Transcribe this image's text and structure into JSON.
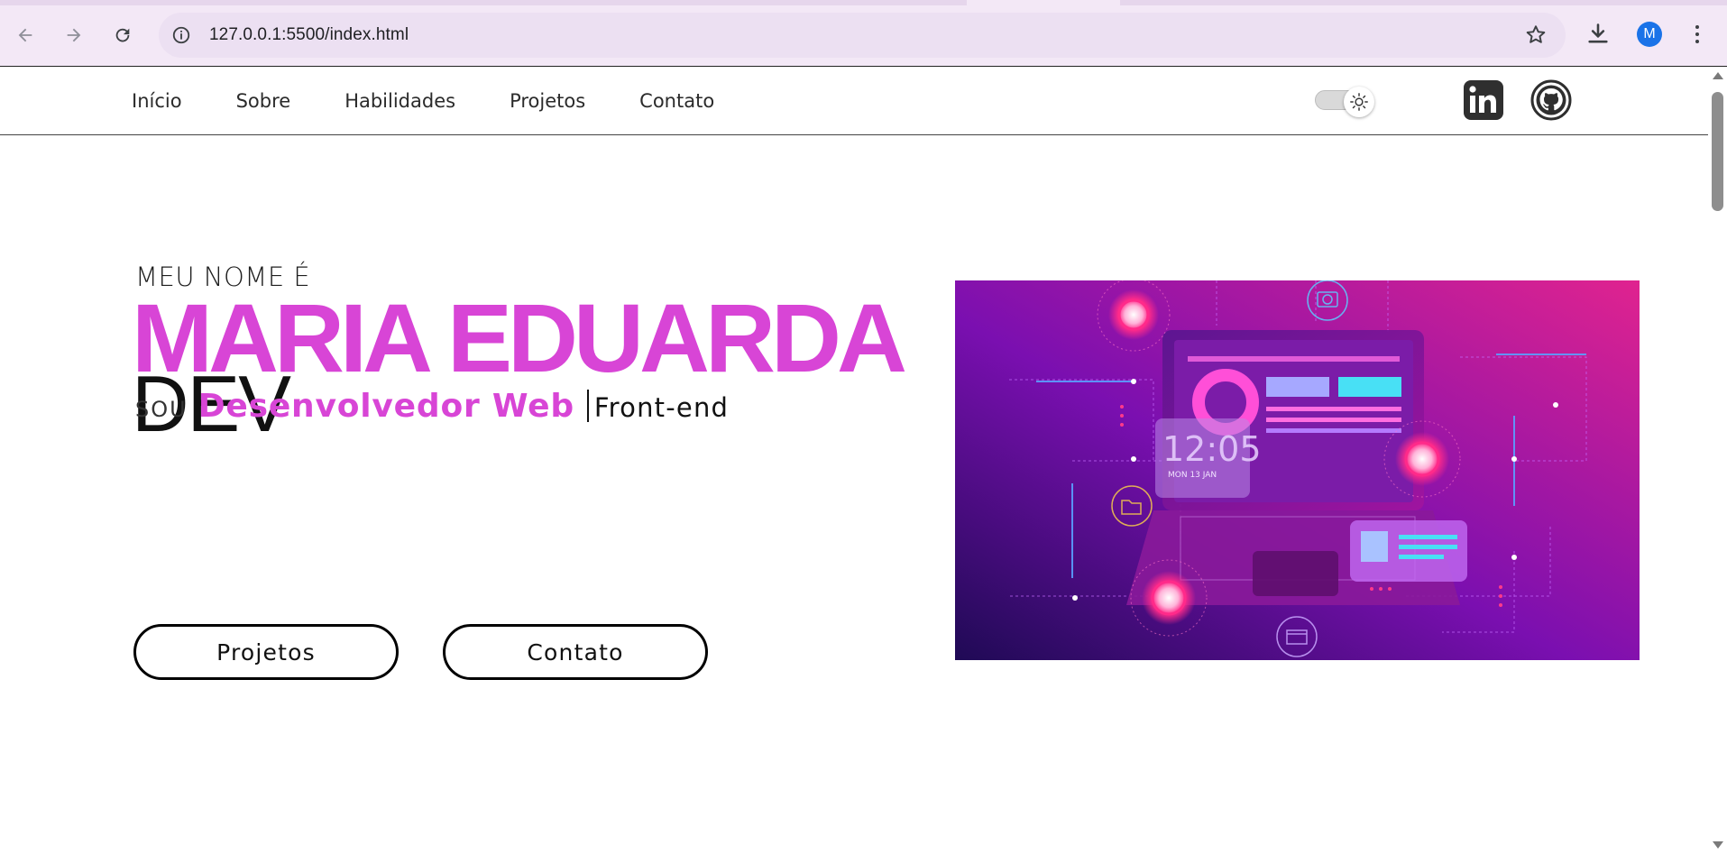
{
  "browser": {
    "url": "127.0.0.1:5500/index.html",
    "profile_initial": "M"
  },
  "nav": {
    "links": [
      "Início",
      "Sobre",
      "Habilidades",
      "Projetos",
      "Contato"
    ]
  },
  "hero": {
    "intro": "MEU NOME É",
    "name": "MARIA EDUARDA",
    "role": "DEV",
    "sou": "SOU",
    "typed": "Desenvolvedor Web",
    "suffix": "Front-end",
    "buttons": {
      "projetos": "Projetos",
      "contato": "Contato"
    },
    "illustration_clock": "12:05",
    "illustration_date": "MON 13 JAN"
  },
  "colors": {
    "accent": "#d845d6",
    "illustration_bg_start": "#2a0a5e",
    "illustration_bg_end": "#e0238f"
  }
}
